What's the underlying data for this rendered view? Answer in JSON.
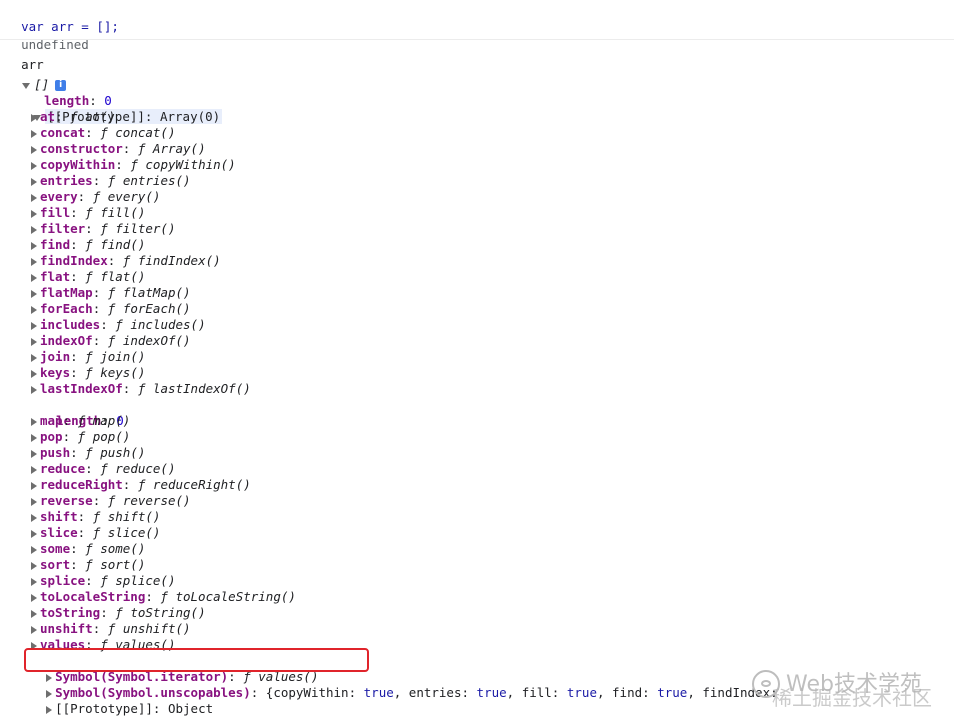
{
  "console": {
    "input1": "var arr = [];",
    "output1": "undefined",
    "input2": "arr",
    "array_label": "[]",
    "info_icon": "i",
    "length_key": "length",
    "length_value": "0",
    "prototype_key": "[[Prototype]]",
    "prototype_value": "Array(0)",
    "methods": [
      {
        "key": "at",
        "value": "at()"
      },
      {
        "key": "concat",
        "value": "concat()"
      },
      {
        "key": "constructor",
        "value": "Array()"
      },
      {
        "key": "copyWithin",
        "value": "copyWithin()"
      },
      {
        "key": "entries",
        "value": "entries()"
      },
      {
        "key": "every",
        "value": "every()"
      },
      {
        "key": "fill",
        "value": "fill()"
      },
      {
        "key": "filter",
        "value": "filter()"
      },
      {
        "key": "find",
        "value": "find()"
      },
      {
        "key": "findIndex",
        "value": "findIndex()"
      },
      {
        "key": "flat",
        "value": "flat()"
      },
      {
        "key": "flatMap",
        "value": "flatMap()"
      },
      {
        "key": "forEach",
        "value": "forEach()"
      },
      {
        "key": "includes",
        "value": "includes()"
      },
      {
        "key": "indexOf",
        "value": "indexOf()"
      },
      {
        "key": "join",
        "value": "join()"
      },
      {
        "key": "keys",
        "value": "keys()"
      },
      {
        "key": "lastIndexOf",
        "value": "lastIndexOf()"
      }
    ],
    "proto_length_key": "length",
    "proto_length_value": "0",
    "methods2": [
      {
        "key": "map",
        "value": "map()"
      },
      {
        "key": "pop",
        "value": "pop()"
      },
      {
        "key": "push",
        "value": "push()"
      },
      {
        "key": "reduce",
        "value": "reduce()"
      },
      {
        "key": "reduceRight",
        "value": "reduceRight()"
      },
      {
        "key": "reverse",
        "value": "reverse()"
      },
      {
        "key": "shift",
        "value": "shift()"
      },
      {
        "key": "slice",
        "value": "slice()"
      },
      {
        "key": "some",
        "value": "some()"
      },
      {
        "key": "sort",
        "value": "sort()"
      },
      {
        "key": "splice",
        "value": "splice()"
      },
      {
        "key": "toLocaleString",
        "value": "toLocaleString()"
      },
      {
        "key": "toString",
        "value": "toString()"
      },
      {
        "key": "unshift",
        "value": "unshift()"
      },
      {
        "key": "values",
        "value": "values()"
      }
    ],
    "iterator_key": "Symbol(Symbol.iterator)",
    "iterator_value": "values()",
    "unscopables_key": "Symbol(Symbol.unscopables)",
    "unscopables_value": "{copyWithin: true, entries: true, fill: true, find: true, findIndex: ",
    "inner_proto_key": "[[Prototype]]",
    "inner_proto_value": "Object",
    "function_glyph": "ƒ",
    "true_text": "true"
  },
  "watermark": {
    "line1": "Web技术学苑",
    "line2": "稀土掘金技术社区"
  },
  "colors": {
    "key": "#881280",
    "number": "#1c00cf",
    "highlight_border": "#e0242b",
    "info_icon": "#3f7ee8"
  }
}
